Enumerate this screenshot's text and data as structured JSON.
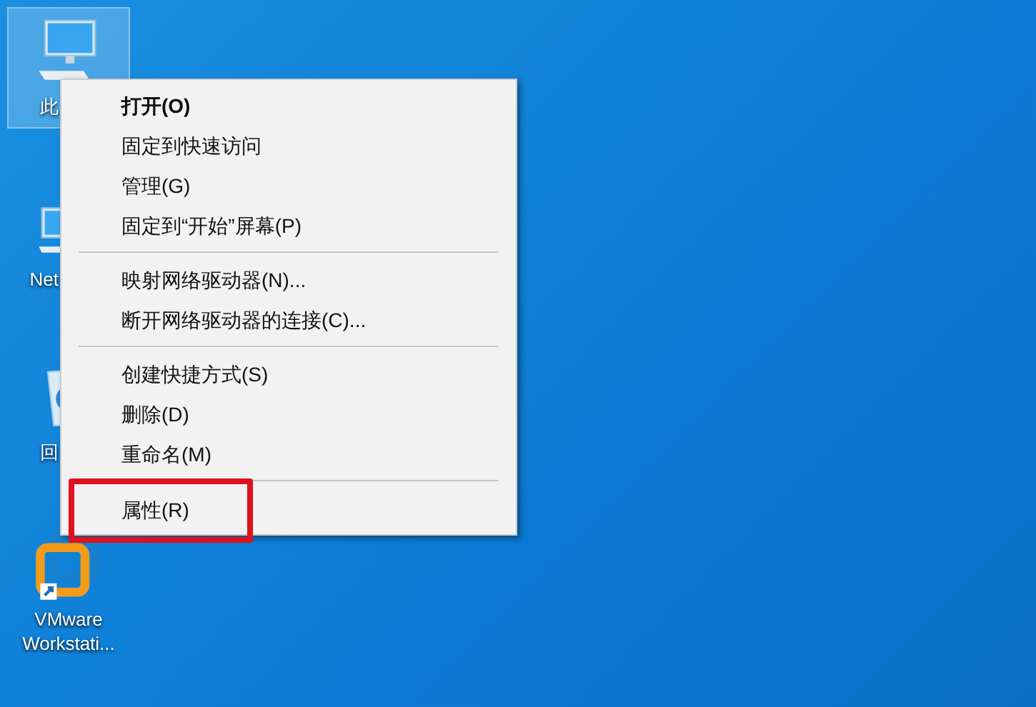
{
  "desktop_icons": [
    {
      "kind": "computer",
      "label": "此",
      "selected": true
    },
    {
      "kind": "network",
      "label": "Net",
      "selected": false
    },
    {
      "kind": "recycle-bin",
      "label": "回",
      "selected": false
    },
    {
      "kind": "vmware",
      "label": "VMware Workstati...",
      "selected": false
    }
  ],
  "context_menu": {
    "sections": [
      [
        {
          "label": "打开(O)",
          "default": true,
          "highlighted": false
        },
        {
          "label": "固定到快速访问",
          "default": false,
          "highlighted": false
        },
        {
          "label": "管理(G)",
          "default": false,
          "highlighted": false
        },
        {
          "label": "固定到“开始”屏幕(P)",
          "default": false,
          "highlighted": false
        }
      ],
      [
        {
          "label": "映射网络驱动器(N)...",
          "default": false,
          "highlighted": false
        },
        {
          "label": "断开网络驱动器的连接(C)...",
          "default": false,
          "highlighted": false
        }
      ],
      [
        {
          "label": "创建快捷方式(S)",
          "default": false,
          "highlighted": false
        },
        {
          "label": "删除(D)",
          "default": false,
          "highlighted": false
        },
        {
          "label": "重命名(M)",
          "default": false,
          "highlighted": false
        }
      ],
      [
        {
          "label": "属性(R)",
          "default": false,
          "highlighted": true
        }
      ]
    ]
  }
}
